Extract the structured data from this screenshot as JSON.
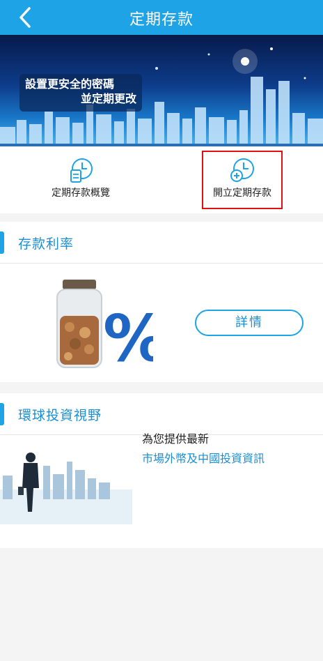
{
  "header": {
    "title": "定期存款",
    "back_icon": "chevron-left-icon"
  },
  "banner": {
    "line1": "設置更安全的密碼",
    "line2": "並定期更改"
  },
  "actions": [
    {
      "label": "定期存款概覽",
      "icon": "clock-document-icon"
    },
    {
      "label": "開立定期存款",
      "icon": "clock-plus-icon"
    }
  ],
  "rates": {
    "title": "存款利率",
    "detail_label": "詳情"
  },
  "global": {
    "title": "環球投資視野",
    "line1": "為您提供最新",
    "line2": "市場外幣及中國投資資訊"
  },
  "colors": {
    "accent": "#1ea3e6",
    "highlight": "#e01010"
  }
}
